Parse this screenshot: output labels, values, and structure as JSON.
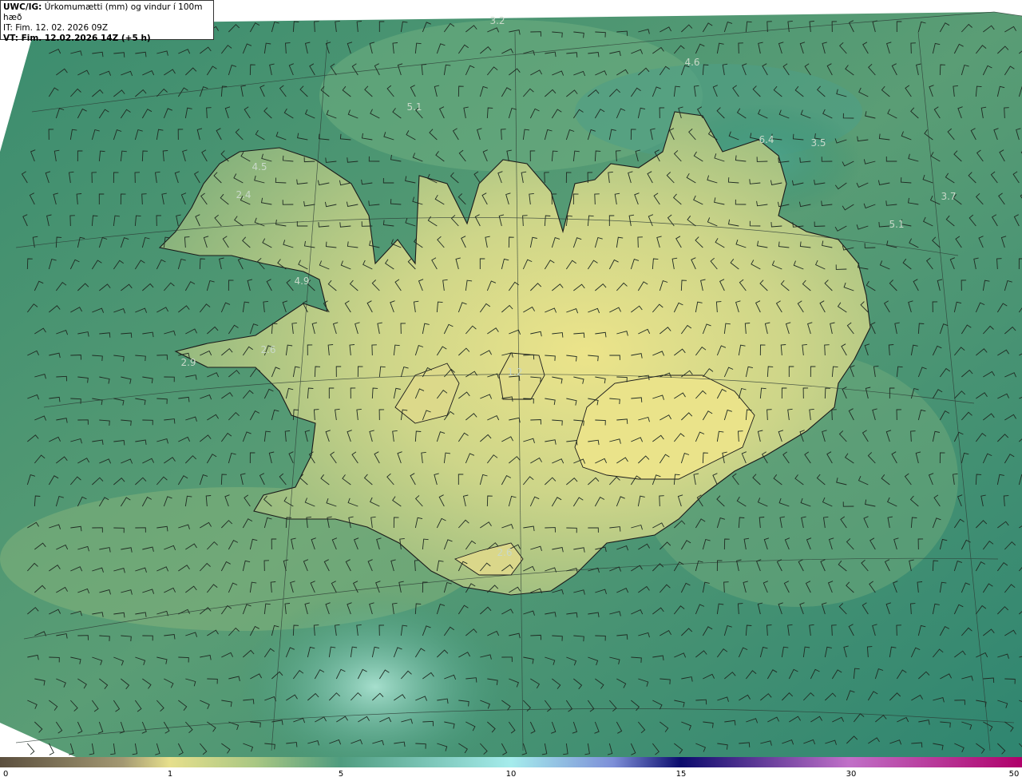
{
  "header": {
    "model": "UWC/IG:",
    "title": " Úrkomumætti (mm) og vindur í 100m hæð",
    "init_time": "IT: Fim. 12. 02. 2026 09Z",
    "valid_time": "VT: Fim. 12.02.2026 14Z (+5 h)"
  },
  "colorbar": {
    "tick_labels": [
      "0",
      "1",
      "5",
      "10",
      "15",
      "30",
      "50"
    ],
    "colors": [
      "#5b4f3e",
      "#b3a778",
      "#e6e08c",
      "#4f9c7f",
      "#a5ecec",
      "#2c2cb0",
      "#0b0b6d",
      "#c070c8",
      "#b0006a"
    ]
  },
  "map_values": [
    "3.2",
    "4.6",
    "5.1",
    "6.4",
    "3.5",
    "4.5",
    "2.4",
    "3.7",
    "5.1",
    "4.9",
    "2.6",
    "2.9",
    "1.2",
    "2.6"
  ],
  "colors": {
    "sea": "#2f8a6e",
    "land_low": "#8ebf7e",
    "land_high": "#e8e48a",
    "coast": "#1a1a1a",
    "grid": "#2c3a34"
  }
}
